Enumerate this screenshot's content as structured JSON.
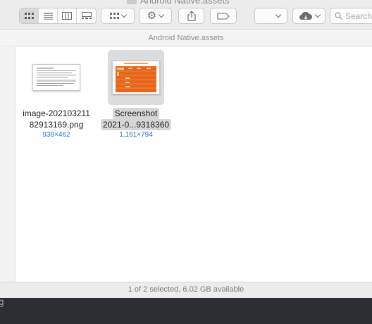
{
  "window": {
    "title": "Android Native.assets"
  },
  "toolbar": {
    "view_modes": [
      "icon-view",
      "list-view",
      "column-view",
      "gallery-view"
    ],
    "active_view": "icon-view",
    "search_placeholder": "Search"
  },
  "path_bar": {
    "label": "Android Native.assets"
  },
  "files": [
    {
      "name_line1": "image-202103211",
      "name_line2": "82913169.png",
      "dimensions": "938×462",
      "selected": false
    },
    {
      "name_line1": "Screenshot",
      "name_line2": "2021-0...9318360",
      "dimensions": "1,161×794",
      "selected": true
    }
  ],
  "status": {
    "text": "1 of 2 selected, 6.02 GB available"
  },
  "terminal_fragment": "g",
  "colors": {
    "accent": "#2f6fd6",
    "selection": "#d6d6d6",
    "thumb_orange": "#e8661a"
  }
}
